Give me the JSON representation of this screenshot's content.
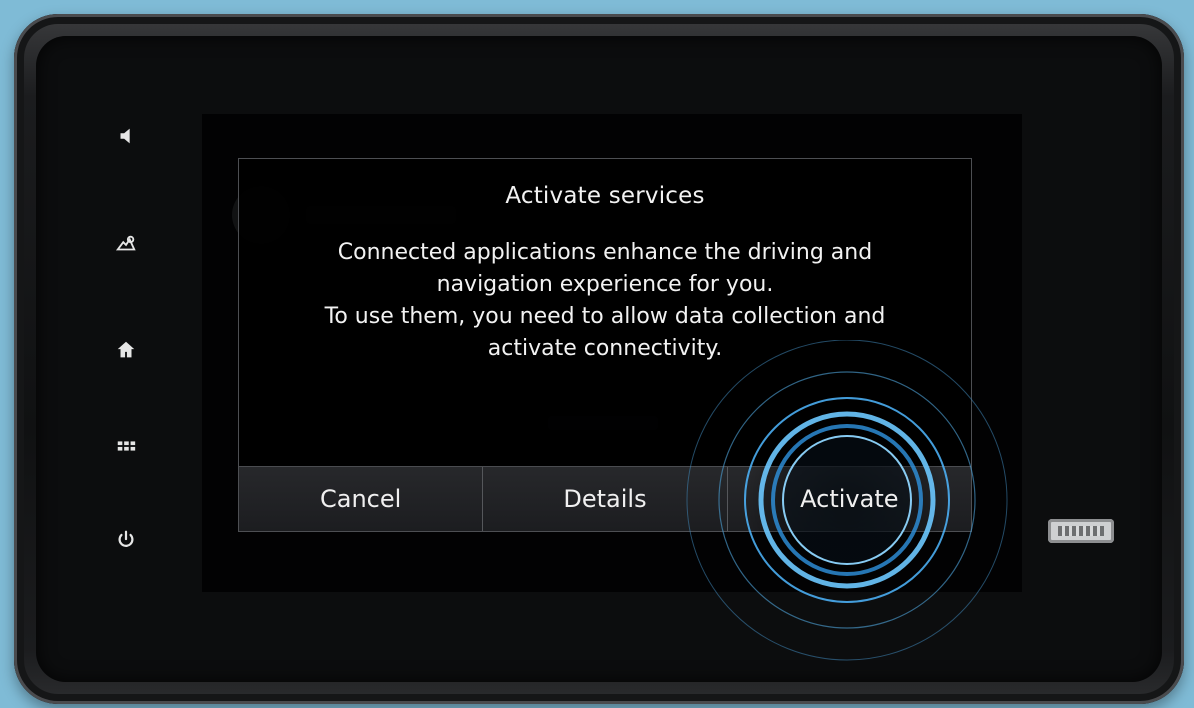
{
  "side_controls": [
    {
      "icon": "volume-icon"
    },
    {
      "icon": "navigation-icon"
    },
    {
      "icon": "home-icon"
    },
    {
      "icon": "apps-grid-icon"
    },
    {
      "icon": "power-icon"
    }
  ],
  "dialog": {
    "title": "Activate services",
    "body_line_1": "Connected applications enhance the driving and",
    "body_line_2": "navigation experience for you.",
    "body_line_3": "To use them, you need to allow data collection and",
    "body_line_4": "activate connectivity.",
    "buttons": {
      "cancel": "Cancel",
      "details": "Details",
      "activate": "Activate"
    }
  },
  "colors": {
    "background": "#7fbbd6",
    "touch_ripple": "#4fb7ff",
    "dialog_border": "#4d4f53"
  }
}
